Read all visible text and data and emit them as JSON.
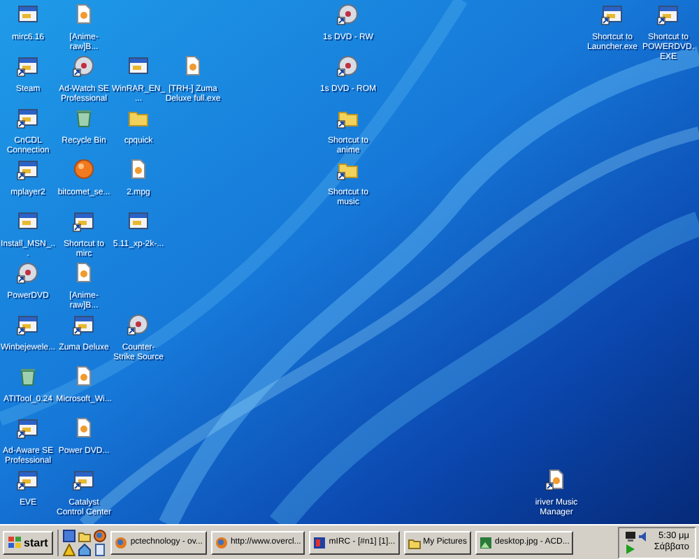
{
  "desktop_icons": [
    {
      "label": "mirc6.16",
      "kind": "window",
      "shortcut": false
    },
    {
      "label": "[Anime-raw]B...",
      "kind": "document",
      "shortcut": false
    },
    {
      "label": "1s DVD - RW",
      "kind": "disc",
      "shortcut": true
    },
    {
      "label": "Shortcut to Launcher.exe",
      "kind": "window",
      "shortcut": true
    },
    {
      "label": "Shortcut to POWERDVD.EXE",
      "kind": "window",
      "shortcut": true
    },
    {
      "label": "Steam",
      "kind": "window",
      "shortcut": true
    },
    {
      "label": "Ad-Watch SE Professional",
      "kind": "disc",
      "shortcut": true
    },
    {
      "label": "WinRAR_EN_...",
      "kind": "window",
      "shortcut": false
    },
    {
      "label": "[TRH-] Zuma Deluxe full.exe",
      "kind": "document",
      "shortcut": false
    },
    {
      "label": "1s DVD - ROM",
      "kind": "disc",
      "shortcut": true
    },
    {
      "label": "CnCDL Connection",
      "kind": "window",
      "shortcut": true
    },
    {
      "label": "Recycle Bin",
      "kind": "bin",
      "shortcut": false
    },
    {
      "label": "cpquick",
      "kind": "folder",
      "shortcut": false
    },
    {
      "label": "Shortcut to anime",
      "kind": "folder",
      "shortcut": true
    },
    {
      "label": "mplayer2",
      "kind": "window",
      "shortcut": true
    },
    {
      "label": "bitcomet_se...",
      "kind": "ball",
      "shortcut": false
    },
    {
      "label": "2.mpg",
      "kind": "document",
      "shortcut": false
    },
    {
      "label": "Shortcut to music",
      "kind": "folder",
      "shortcut": true
    },
    {
      "label": "Install_MSN_...",
      "kind": "window",
      "shortcut": false
    },
    {
      "label": "Shortcut to mirc",
      "kind": "window",
      "shortcut": true
    },
    {
      "label": "5.11_xp-2k-...",
      "kind": "window",
      "shortcut": false
    },
    {
      "label": "PowerDVD",
      "kind": "disc",
      "shortcut": true
    },
    {
      "label": "[Anime-raw]B...",
      "kind": "document",
      "shortcut": false
    },
    {
      "label": "Winbejewele...",
      "kind": "window",
      "shortcut": true
    },
    {
      "label": "Zuma Deluxe",
      "kind": "window",
      "shortcut": true
    },
    {
      "label": "Counter-Strike Source",
      "kind": "disc",
      "shortcut": true
    },
    {
      "label": "ATITool_0.24",
      "kind": "bin",
      "shortcut": false
    },
    {
      "label": "Microsoft_Wi...",
      "kind": "document",
      "shortcut": false
    },
    {
      "label": "Ad-Aware SE Professional",
      "kind": "window",
      "shortcut": true
    },
    {
      "label": "Power DVD...",
      "kind": "document",
      "shortcut": false
    },
    {
      "label": "EVE",
      "kind": "window",
      "shortcut": true
    },
    {
      "label": "Catalyst Control Center",
      "kind": "window",
      "shortcut": true
    },
    {
      "label": "iriver Music Manager",
      "kind": "document",
      "shortcut": true
    }
  ],
  "taskbar": {
    "start_button": "start",
    "tasks": [
      {
        "label": "pctechnology - ov...",
        "selected": false
      },
      {
        "label": "http://www.overcl...",
        "selected": false
      },
      {
        "label": "mIRC - [#n1] [1]...",
        "selected": false
      },
      {
        "label": "My Pictures",
        "selected": false
      },
      {
        "label": "desktop.jpg - ACD...",
        "selected": false
      }
    ],
    "clock": {
      "time": "5:30 μμ",
      "day": "Σάββατο"
    }
  }
}
